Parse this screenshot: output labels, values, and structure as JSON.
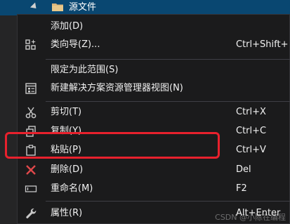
{
  "tree": {
    "folder_label": "源文件"
  },
  "menu": {
    "items": [
      {
        "label": "添加(D)",
        "shortcut": ""
      },
      {
        "label": "类向导(Z)...",
        "shortcut": "Ctrl+Shift+"
      },
      {
        "label": "限定为此范围(S)",
        "shortcut": ""
      },
      {
        "label": "新建解决方案资源管理器视图(N)",
        "shortcut": ""
      },
      {
        "label": "剪切(T)",
        "shortcut": "Ctrl+X"
      },
      {
        "label": "复制(Y)",
        "shortcut": "Ctrl+C"
      },
      {
        "label": "粘贴(P)",
        "shortcut": "Ctrl+V"
      },
      {
        "label": "删除(D)",
        "shortcut": "Del"
      },
      {
        "label": "重命名(M)",
        "shortcut": "F2"
      },
      {
        "label": "属性(R)",
        "shortcut": "Alt+Enter"
      }
    ]
  },
  "colors": {
    "menu_bg": "#1b1b1c",
    "text": "#f1f1f1",
    "highlight_box": "#e8212d",
    "selected_row": "#094771"
  },
  "watermark": "CSDN @小陈在编程"
}
